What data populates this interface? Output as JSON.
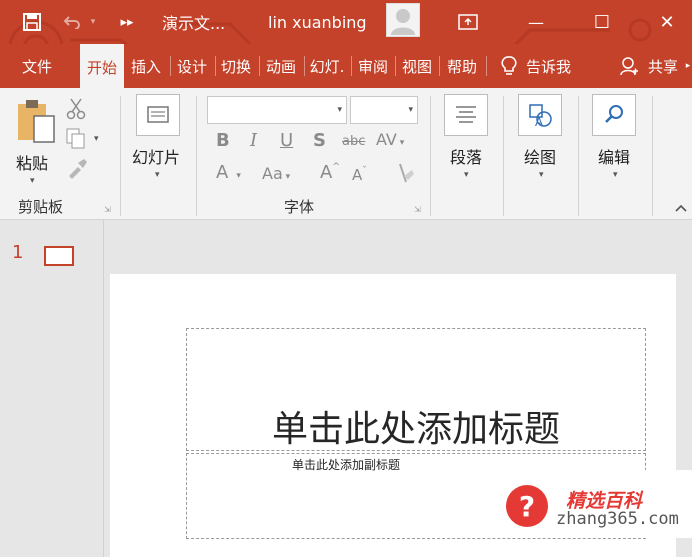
{
  "titlebar": {
    "more_glyph": "▸▸",
    "doc_title": "演示文...",
    "user_name": "lin xuanbing",
    "min_glyph": "—",
    "max_glyph": "☐",
    "close_glyph": "✕"
  },
  "tabs": [
    {
      "label": "文件"
    },
    {
      "label": "开始"
    },
    {
      "label": "插入"
    },
    {
      "label": "设计"
    },
    {
      "label": "切换"
    },
    {
      "label": "动画"
    },
    {
      "label": "幻灯."
    },
    {
      "label": "审阅"
    },
    {
      "label": "视图"
    },
    {
      "label": "帮助"
    },
    {
      "label": "告诉我"
    },
    {
      "label": "共享"
    }
  ],
  "ribbon": {
    "clipboard": {
      "paste": "粘贴",
      "group": "剪贴板"
    },
    "slides": {
      "new_slide": "幻灯片"
    },
    "font": {
      "group": "字体",
      "bold": "B",
      "italic": "I",
      "underline": "U",
      "shadow": "S",
      "strike": "abc",
      "spacing": "AV",
      "color": "A",
      "case": "Aa",
      "grow": "A",
      "shrink": "A"
    },
    "paragraph": {
      "label": "段落"
    },
    "drawing": {
      "label": "绘图"
    },
    "editing": {
      "label": "编辑"
    }
  },
  "slides_pane": {
    "number": "1"
  },
  "slide": {
    "title_placeholder": "单击此处添加标题",
    "subtitle_placeholder": "单击此处添加副标题"
  },
  "watermark": {
    "brand": "精选百科",
    "site": "zhang365.com"
  },
  "colors": {
    "accent": "#c4412a",
    "watermark_red": "#e53935"
  }
}
